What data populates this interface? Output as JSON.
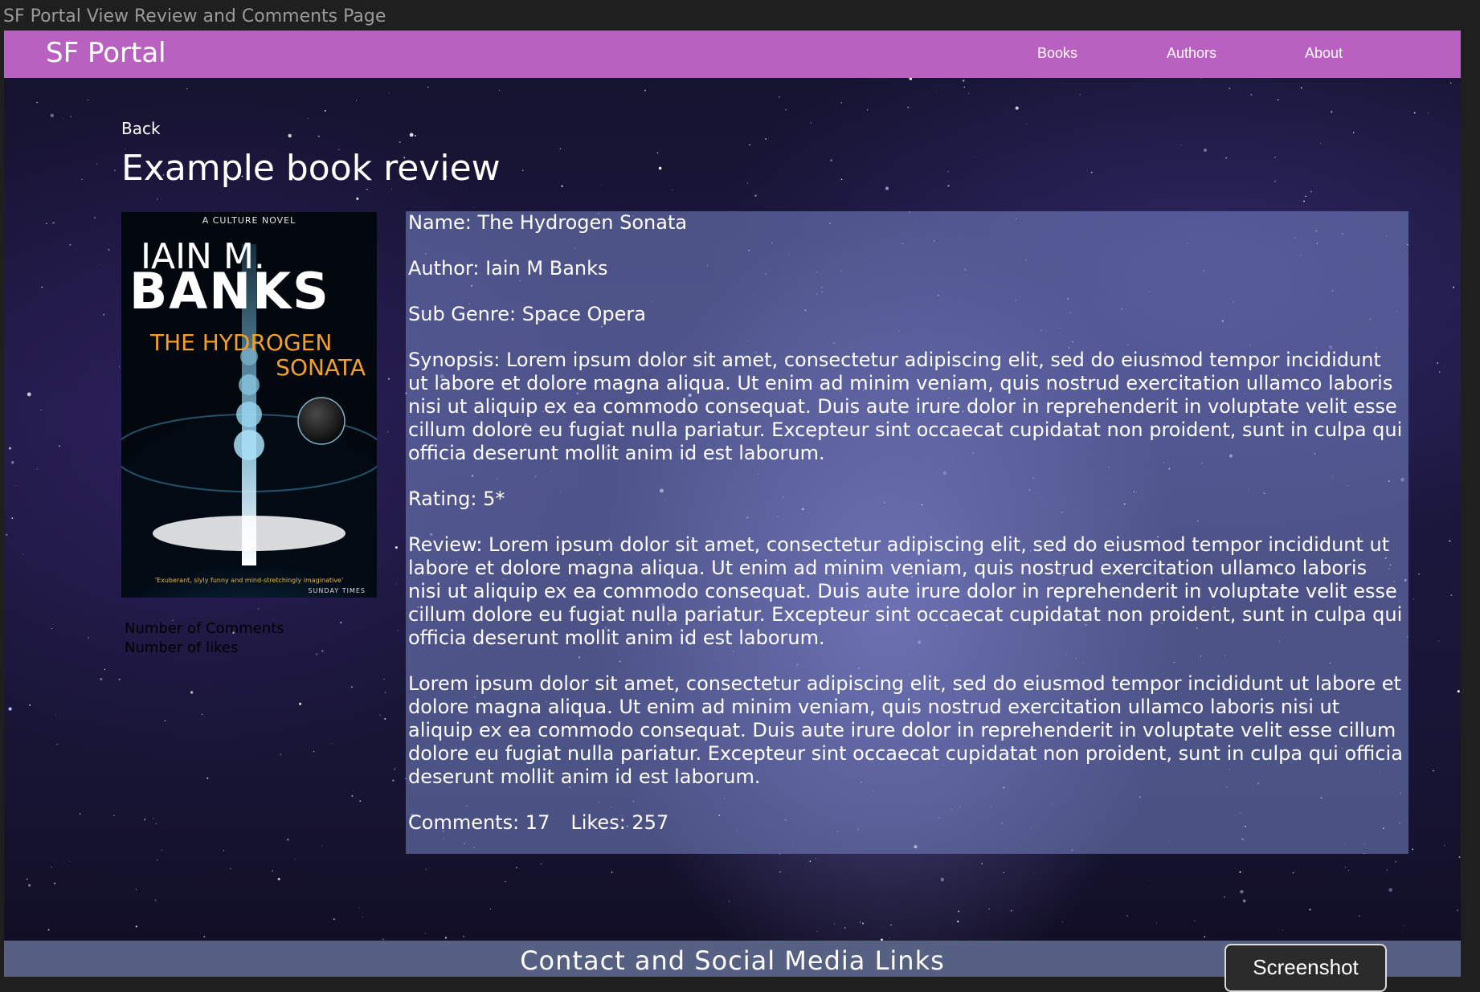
{
  "window": {
    "title": "SF Portal View Review and Comments Page"
  },
  "navbar": {
    "brand": "SF Portal",
    "links": [
      {
        "label": "Books"
      },
      {
        "label": "Authors"
      },
      {
        "label": "About"
      }
    ],
    "background_color": "#b861c0"
  },
  "page": {
    "back_label": "Back",
    "title": "Example book review"
  },
  "cover": {
    "series": "A CULTURE NOVEL",
    "author_first": "IAIN M.",
    "author_last": "BANKS",
    "title_line1": "THE HYDROGEN",
    "title_line2": "SONATA",
    "quote": "'Exuberant, slyly funny and mind-stretchingly imaginative'",
    "quote_source": "SUNDAY TIMES",
    "title_color": "#f0a030"
  },
  "side_stats": {
    "comments_label": "Number of Comments",
    "likes_label": "Number of likes"
  },
  "review": {
    "name": "Name: The Hydrogen Sonata",
    "author": "Author: Iain M Banks",
    "sub_genre": "Sub Genre: Space Opera",
    "synopsis": "Synopsis:  Lorem ipsum dolor sit amet, consectetur adipiscing elit, sed do eiusmod tempor incididunt ut labore et dolore magna aliqua. Ut enim ad minim veniam, quis nostrud exercitation ullamco laboris nisi ut aliquip ex ea commodo consequat. Duis aute irure dolor in reprehenderit in voluptate velit esse cillum dolore eu fugiat nulla pariatur. Excepteur sint occaecat cupidatat non proident, sunt in culpa qui officia deserunt mollit anim id est laborum.",
    "rating": "Rating: 5*",
    "review_p1": "Review:  Lorem ipsum dolor sit amet, consectetur adipiscing elit, sed do eiusmod tempor incididunt ut labore et dolore magna aliqua. Ut enim ad minim veniam, quis nostrud exercitation ullamco laboris nisi ut aliquip ex ea commodo consequat. Duis aute irure dolor in reprehenderit in voluptate velit esse cillum dolore eu fugiat nulla pariatur. Excepteur sint occaecat cupidatat non proident, sunt in culpa qui officia deserunt mollit anim id est laborum.",
    "review_p2": "Lorem ipsum dolor sit amet, consectetur adipiscing elit, sed do eiusmod tempor incididunt ut labore et dolore magna aliqua. Ut enim ad minim veniam, quis nostrud exercitation ullamco laboris nisi ut aliquip ex ea commodo consequat. Duis aute irure dolor in reprehenderit in voluptate velit esse cillum dolore eu fugiat nulla pariatur. Excepteur sint occaecat cupidatat non proident, sunt in culpa qui officia deserunt mollit anim id est laborum.",
    "comments": "Comments: 17",
    "likes": "Likes: 257"
  },
  "footer": {
    "title": "Contact and Social Media Links",
    "background_color": "#556083"
  },
  "screenshot_button": {
    "label": "Screenshot"
  }
}
